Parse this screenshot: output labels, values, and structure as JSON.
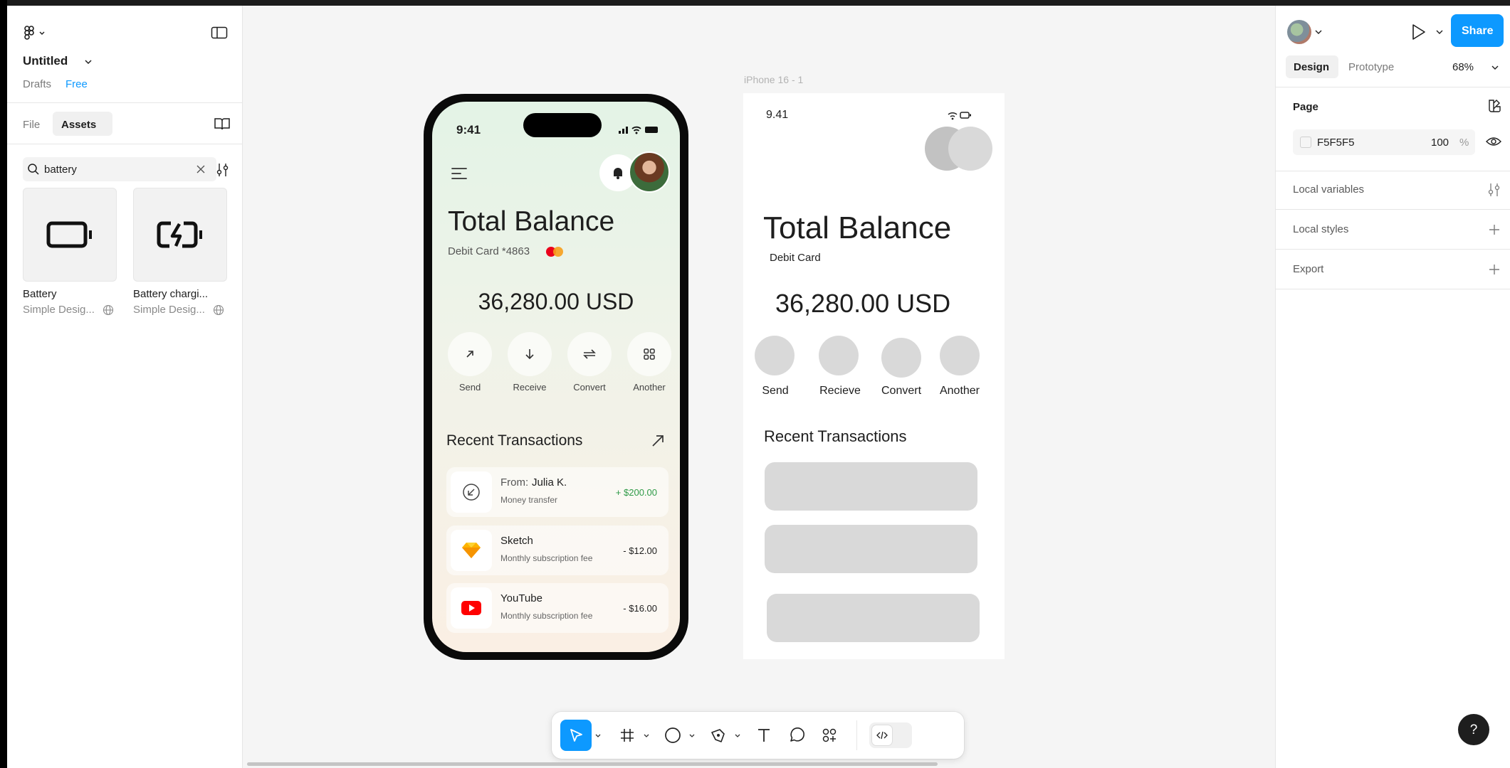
{
  "left_panel": {
    "file_title": "Untitled",
    "drafts": "Drafts",
    "plan_badge": "Free",
    "tabs": [
      "File",
      "Assets"
    ],
    "search": {
      "value": "battery"
    },
    "assets": [
      {
        "name": "Battery",
        "source": "Simple Desig..."
      },
      {
        "name": "Battery chargi...",
        "source": "Simple Desig..."
      }
    ]
  },
  "canvas": {
    "frame_label": "iPhone 16 - 1",
    "phone": {
      "time": "9:41",
      "title": "Total Balance",
      "card": "Debit Card *4863",
      "balance": "36,280.00 USD",
      "actions": [
        "Send",
        "Receive",
        "Convert",
        "Another"
      ],
      "recent_title": "Recent Transactions",
      "transactions": [
        {
          "title_prefix": "From: ",
          "title": "Julia K.",
          "subtitle": "Money transfer",
          "amount": "+ $200.00",
          "amount_color": "#2e9a47"
        },
        {
          "title_prefix": "",
          "title": "Sketch",
          "subtitle": "Monthly subscription fee",
          "amount": "- $12.00",
          "amount_color": "#1e1e1e"
        },
        {
          "title_prefix": "",
          "title": "YouTube",
          "subtitle": "Monthly subscription fee",
          "amount": "- $16.00",
          "amount_color": "#1e1e1e"
        }
      ]
    },
    "wireframe": {
      "time": "9.41",
      "title": "Total Balance",
      "card": "Debit Card",
      "balance": "36,280.00 USD",
      "actions": [
        "Send",
        "Recieve",
        "Convert",
        "Another"
      ],
      "recent_title": "Recent Transactions"
    }
  },
  "right_panel": {
    "share_label": "Share",
    "tabs": [
      "Design",
      "Prototype"
    ],
    "zoom": "68%",
    "page_label": "Page",
    "page_color": "F5F5F5",
    "page_opacity": "100",
    "percent": "%",
    "sections": [
      "Local variables",
      "Local styles",
      "Export"
    ],
    "help": "?"
  },
  "colors": {
    "accent": "#0d99ff",
    "canvas_bg": "#f5f5f5",
    "wire_grey": "#d9d9d9",
    "positive": "#2e9a47"
  }
}
